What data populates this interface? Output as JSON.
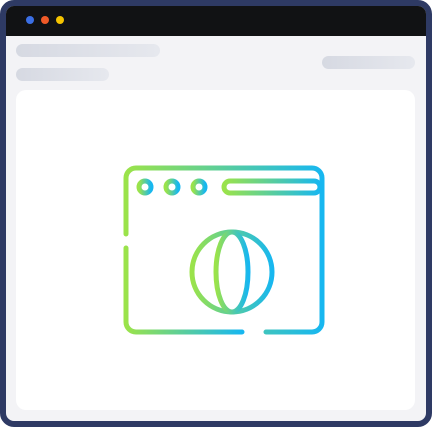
{
  "window": {
    "frame_color": "#2e3a64",
    "titlebar_color": "#111214",
    "traffic_lights": [
      {
        "name": "blue-dot",
        "color": "#3b6fe5"
      },
      {
        "name": "orange-dot",
        "color": "#f05a28"
      },
      {
        "name": "yellow-dot",
        "color": "#f5c400"
      }
    ]
  },
  "header": {
    "placeholders": [
      "title-skeleton",
      "subtitle-skeleton",
      "action-skeleton"
    ]
  },
  "main": {
    "illustration": {
      "icon": "browser-globe-icon",
      "gradient_start": "#9be34a",
      "gradient_end": "#17b7f0"
    }
  }
}
